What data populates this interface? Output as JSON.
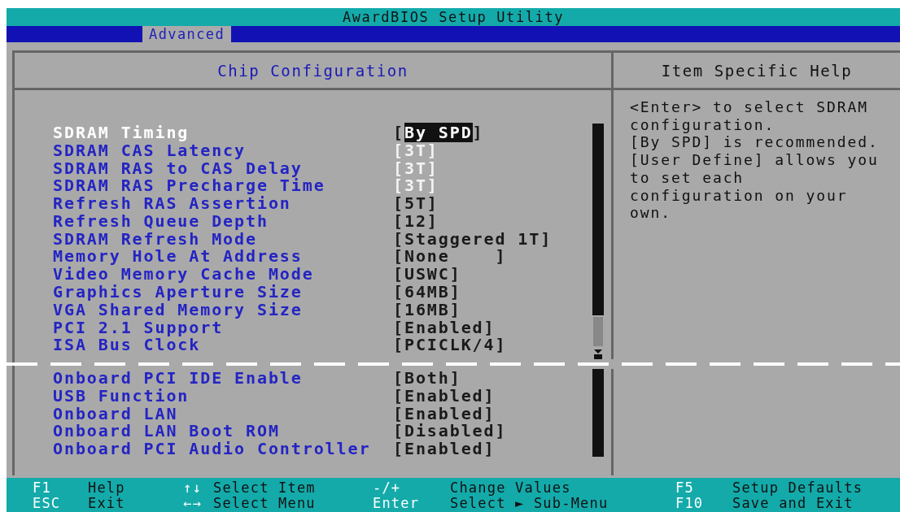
{
  "window": {
    "title": "AwardBIOS Setup Utility"
  },
  "tabs": [
    {
      "label": "Advanced",
      "selected": true
    }
  ],
  "panel": {
    "title": "Chip Configuration",
    "help_title": "Item Specific Help"
  },
  "sections": [
    {
      "items": [
        {
          "label": "SDRAM Timing",
          "value": "[By SPD]",
          "selected": true,
          "disabled": false
        },
        {
          "label": "SDRAM CAS Latency",
          "value": "[3T]",
          "selected": false,
          "disabled": true
        },
        {
          "label": "SDRAM RAS to CAS Delay",
          "value": "[3T]",
          "selected": false,
          "disabled": true
        },
        {
          "label": "SDRAM RAS Precharge Time",
          "value": "[3T]",
          "selected": false,
          "disabled": true
        },
        {
          "label": "Refresh RAS Assertion",
          "value": "[5T]",
          "selected": false,
          "disabled": false
        },
        {
          "label": "Refresh Queue Depth",
          "value": "[12]",
          "selected": false,
          "disabled": false
        },
        {
          "label": "SDRAM Refresh Mode",
          "value": "[Staggered 1T]",
          "selected": false,
          "disabled": false
        },
        {
          "label": "Memory Hole At Address",
          "value": "[None    ]",
          "selected": false,
          "disabled": false
        },
        {
          "label": "Video Memory Cache Mode",
          "value": "[USWC]",
          "selected": false,
          "disabled": false
        },
        {
          "label": "Graphics Aperture Size",
          "value": "[64MB]",
          "selected": false,
          "disabled": false
        },
        {
          "label": "VGA Shared Memory Size",
          "value": "[16MB]",
          "selected": false,
          "disabled": false
        },
        {
          "label": "PCI 2.1 Support",
          "value": "[Enabled]",
          "selected": false,
          "disabled": false
        },
        {
          "label": "ISA Bus Clock",
          "value": "[PCICLK/4]",
          "selected": false,
          "disabled": false
        }
      ]
    },
    {
      "items": [
        {
          "label": "Onboard PCI IDE Enable",
          "value": "[Both]",
          "selected": false,
          "disabled": false
        },
        {
          "label": "USB Function",
          "value": "[Enabled]",
          "selected": false,
          "disabled": false
        },
        {
          "label": "Onboard LAN",
          "value": "[Enabled]",
          "selected": false,
          "disabled": false
        },
        {
          "label": "Onboard LAN Boot ROM",
          "value": "[Disabled]",
          "selected": false,
          "disabled": false
        },
        {
          "label": "Onboard PCI Audio Controller",
          "value": "[Enabled]",
          "selected": false,
          "disabled": false
        }
      ]
    }
  ],
  "help_text": "<Enter> to select SDRAM\nconfiguration.\n[By SPD] is recommended.\n[User Define] allows you\nto set each\nconfiguration on your\nown.",
  "footer": [
    [
      {
        "key": "F1",
        "action": "Help"
      },
      {
        "key": "↑↓",
        "action": "Select Item"
      },
      {
        "key": "-/+",
        "action": "Change Values"
      },
      {
        "key": "F5",
        "action": "Setup Defaults"
      }
    ],
    [
      {
        "key": "ESC",
        "action": "Exit"
      },
      {
        "key": "←→",
        "action": "Select Menu"
      },
      {
        "key": "Enter",
        "action": "Select ► Sub-Menu"
      },
      {
        "key": "F10",
        "action": "Save and Exit"
      }
    ]
  ]
}
